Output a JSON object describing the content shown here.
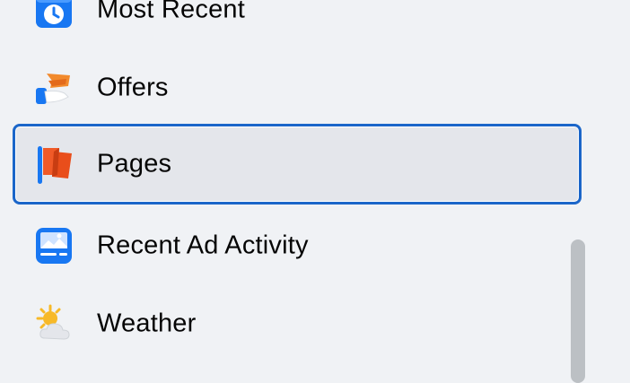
{
  "menu": {
    "items": [
      {
        "label": "Most Recent",
        "icon": "clock-calendar-icon",
        "selected": false
      },
      {
        "label": "Offers",
        "icon": "offers-tag-hand-icon",
        "selected": false
      },
      {
        "label": "Pages",
        "icon": "flag-icon",
        "selected": true
      },
      {
        "label": "Recent Ad Activity",
        "icon": "ad-screen-icon",
        "selected": false
      },
      {
        "label": "Weather",
        "icon": "sun-cloud-icon",
        "selected": false
      }
    ]
  },
  "colors": {
    "background": "#f0f2f5",
    "selected_background": "#e4e6eb",
    "focus_border": "#1b66c9",
    "scrollbar": "#bcc0c4"
  }
}
